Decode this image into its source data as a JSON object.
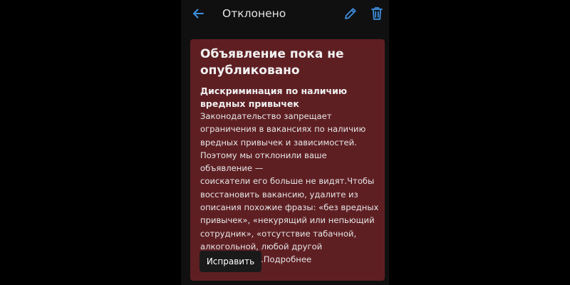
{
  "header": {
    "title": "Отклонено",
    "back_icon": "arrow-left-icon",
    "edit_icon": "pencil-icon",
    "delete_icon": "trash-icon",
    "accent_color": "#3d8fe0"
  },
  "notice": {
    "title": "Объявление пока не опубликовано",
    "reason": "Дискриминация по наличию вредных привычек",
    "body_lines": [
      "Законодательство запрещает",
      "ограничения в вакансиях по наличию",
      "вредных привычек и зависимостей.",
      "Поэтому мы отклонили ваше объявление —",
      "соискатели его больше не видят.Чтобы",
      "восстановить вакансию, удалите из",
      "описания похожие фразы: «без вредных",
      "привычек», «некурящий или непьющий",
      "сотрудник», «отсутствие табачной,",
      "алкогольной, любой другой",
      "зависимости»."
    ],
    "more_link": "Подробнее",
    "fix_button": "Исправить",
    "background_color": "#5e1f23"
  }
}
